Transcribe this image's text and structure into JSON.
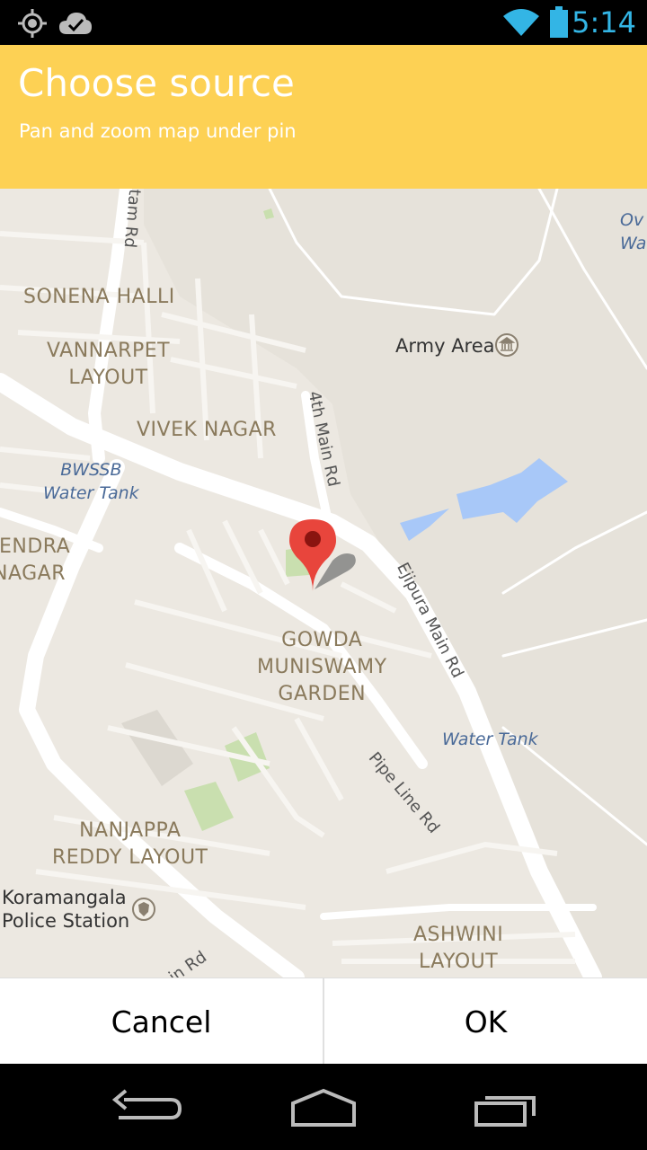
{
  "status_bar": {
    "time": "5:14",
    "left_icons": [
      "gps-icon",
      "cloud-check-icon"
    ],
    "right_icons": [
      "wifi-icon",
      "battery-icon"
    ],
    "accent": "#33b5e5"
  },
  "header": {
    "title": "Choose source",
    "subtitle": "Pan and zoom map under pin",
    "background": "#fdd154"
  },
  "map": {
    "areas": [
      {
        "id": "sonena-halli",
        "text": "SONENA HALLI"
      },
      {
        "id": "vannarpet-layout",
        "text": "VANNARPET\nLAYOUT"
      },
      {
        "id": "vivek-nagar",
        "text": "VIVEK NAGAR"
      },
      {
        "id": "rajendra-nagar",
        "text": "JENDRA\nNAGAR"
      },
      {
        "id": "gowda-muniswamy-garden",
        "text": "GOWDA\nMUNISWAMY\nGARDEN"
      },
      {
        "id": "nanjappa-reddy-layout",
        "text": "NANJAPPA\nREDDY LAYOUT"
      },
      {
        "id": "ashwini-layout",
        "text": "ASHWINI\nLAYOUT"
      }
    ],
    "pois": [
      {
        "id": "army-area",
        "text": "Army Area"
      },
      {
        "id": "bwssb-water-tank",
        "text": "BWSSB\nWater Tank"
      },
      {
        "id": "water-tank",
        "text": "Water Tank"
      },
      {
        "id": "koramangala-police-station",
        "text": "Koramangala\nPolice Station"
      },
      {
        "id": "ov-wa",
        "text": "Ov\nWa"
      }
    ],
    "roads": [
      {
        "id": "4th-main-rd",
        "text": "4th Main Rd"
      },
      {
        "id": "ejipura-main-rd",
        "text": "Ejipura Main Rd"
      },
      {
        "id": "pipe-line-rd",
        "text": "Pipe Line Rd"
      },
      {
        "id": "astam-rd",
        "text": "stam Rd"
      },
      {
        "id": "in-rd",
        "text": "in Rd"
      }
    ],
    "marker": "map-pin-icon"
  },
  "buttons": {
    "cancel": "Cancel",
    "ok": "OK"
  },
  "navbar": {
    "icons": [
      "back-icon",
      "home-icon",
      "recent-apps-icon"
    ]
  }
}
